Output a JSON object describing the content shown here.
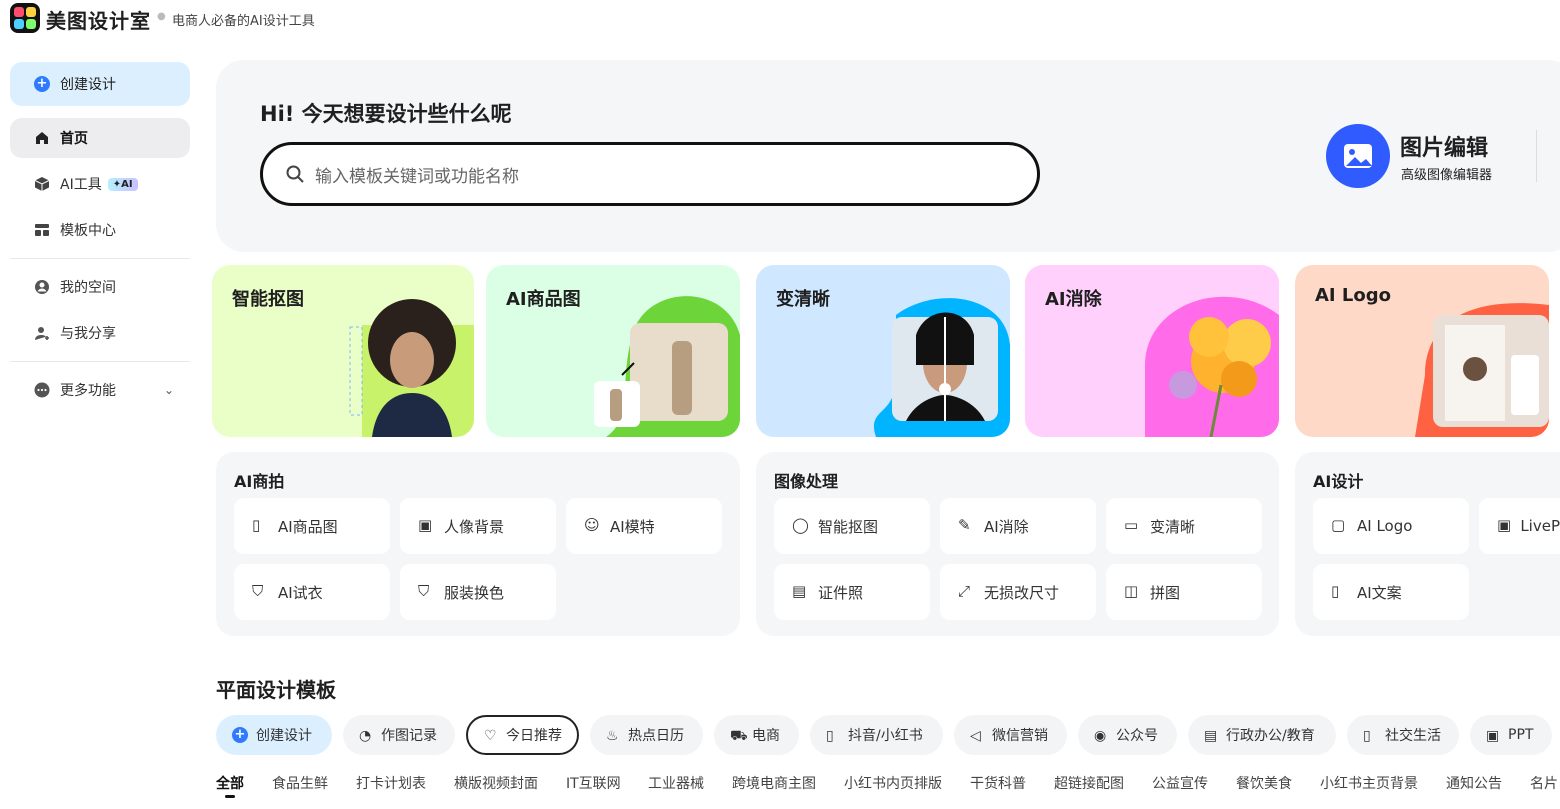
{
  "app": {
    "brand": "美图设计室",
    "slogan": "电商人必备的AI设计工具"
  },
  "sidebar": {
    "create": "创建设计",
    "items": [
      {
        "label": "首页"
      },
      {
        "label": "AI工具",
        "badge": "✦AI"
      },
      {
        "label": "模板中心"
      },
      {
        "label": "我的空间"
      },
      {
        "label": "与我分享"
      },
      {
        "label": "更多功能"
      }
    ]
  },
  "hero": {
    "greeting": "Hi!   今天想要设计些什么呢",
    "search_placeholder": "输入模板关键词或功能名称",
    "editor_title": "图片编辑",
    "editor_sub": "高级图像编辑器"
  },
  "cards": [
    {
      "title": "智能抠图"
    },
    {
      "title": "AI商品图"
    },
    {
      "title": "变清晰"
    },
    {
      "title": "AI消除"
    },
    {
      "title": "AI Logo"
    }
  ],
  "panels": [
    {
      "title": "AI商拍",
      "tools": [
        "AI商品图",
        "人像背景",
        "AI模特",
        "AI试衣",
        "服装换色"
      ]
    },
    {
      "title": "图像处理",
      "tools": [
        "智能抠图",
        "AI消除",
        "变清晰",
        "证件照",
        "无损改尺寸",
        "拼图"
      ]
    },
    {
      "title": "AI设计",
      "tools": [
        "AI Logo",
        "LiveP",
        "AI文案"
      ]
    }
  ],
  "templates": {
    "title": "平面设计模板",
    "chips": [
      "创建设计",
      "作图记录",
      "今日推荐",
      "热点日历",
      "电商",
      "抖音/小红书",
      "微信营销",
      "公众号",
      "行政办公/教育",
      "社交生活",
      "PPT"
    ],
    "categories": [
      "全部",
      "食品生鲜",
      "打卡计划表",
      "横版视频封面",
      "IT互联网",
      "工业器械",
      "跨境电商主图",
      "小红书内页排版",
      "干货科普",
      "超链接配图",
      "公益宣传",
      "餐饮美食",
      "小红书主页背景",
      "通知公告",
      "名片"
    ]
  }
}
